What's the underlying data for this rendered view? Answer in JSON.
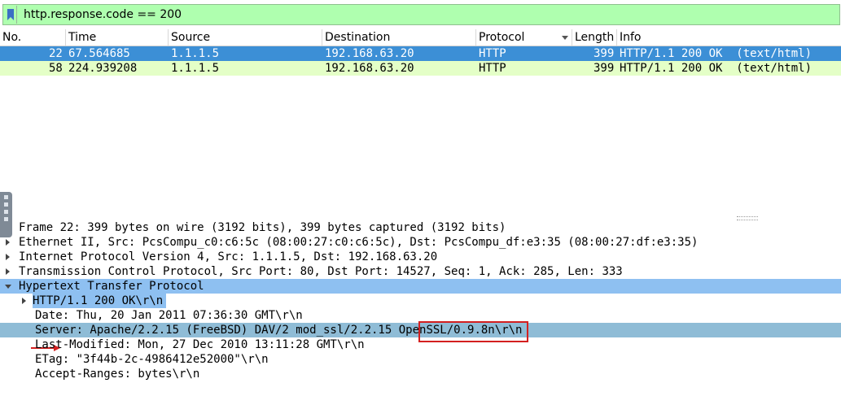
{
  "filter": {
    "text": "http.response.code == 200"
  },
  "columns": [
    "No.",
    "Time",
    "Source",
    "Destination",
    "Protocol",
    "Length",
    "Info"
  ],
  "packets": [
    {
      "no": "22",
      "time": "67.564685",
      "source": "1.1.1.5",
      "destination": "192.168.63.20",
      "protocol": "HTTP",
      "length": "399",
      "info": "HTTP/1.1 200 OK  (text/html)"
    },
    {
      "no": "58",
      "time": "224.939208",
      "source": "1.1.1.5",
      "destination": "192.168.63.20",
      "protocol": "HTTP",
      "length": "399",
      "info": "HTTP/1.1 200 OK  (text/html)"
    }
  ],
  "details": {
    "frame": "Frame 22: 399 bytes on wire (3192 bits), 399 bytes captured (3192 bits)",
    "ethernet": "Ethernet II, Src: PcsCompu_c0:c6:5c (08:00:27:c0:c6:5c), Dst: PcsCompu_df:e3:35 (08:00:27:df:e3:35)",
    "ip": "Internet Protocol Version 4, Src: 1.1.1.5, Dst: 192.168.63.20",
    "tcp": "Transmission Control Protocol, Src Port: 80, Dst Port: 14527, Seq: 1, Ack: 285, Len: 333",
    "http": "Hypertext Transfer Protocol",
    "status_line": "HTTP/1.1 200 OK\\r\\n",
    "date": "Date: Thu, 20 Jan 2011 07:36:30 GMT\\r\\n",
    "server_prefix": "Server: Apache/2.2.15 (FreeBSD) DAV/2 mod_ssl/2.2.15 ",
    "server_openssl": "OpenSSL/0.9.8n",
    "server_suffix": "\\r\\n",
    "last_modified": "Last-Modified: Mon, 27 Dec 2010 13:11:28 GMT\\r\\n",
    "etag": "ETag: \"3f44b-2c-4986412e52000\"\\r\\n",
    "accept_ranges": "Accept-Ranges: bytes\\r\\n"
  },
  "colors": {
    "selected_row": "#3c8fd6",
    "http_row": "#e4ffc7",
    "filter_valid": "#afffaf",
    "annotation_red": "#d42020"
  }
}
